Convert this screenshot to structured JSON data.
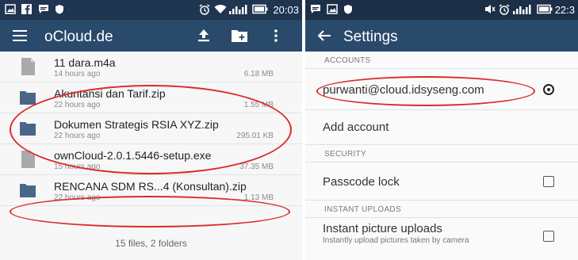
{
  "colors": {
    "app_bar": "#2a4a6c",
    "status_bar": "#1f3550",
    "annotation": "#dd2a2a"
  },
  "left_screen": {
    "status_bar": {
      "time": "20:03",
      "icons": [
        "image-icon",
        "facebook-icon",
        "chat-icon",
        "shield-icon",
        "alarm-icon",
        "wifi-icon",
        "signal-icon",
        "battery-icon"
      ]
    },
    "app_bar": {
      "title": "oCloud.de",
      "icons": [
        "menu-icon",
        "upload-icon",
        "new-folder-icon",
        "more-icon"
      ]
    },
    "files": [
      {
        "name": "11 dara.m4a",
        "time": "14 hours ago",
        "size": "6.18 MB",
        "kind": "file"
      },
      {
        "name": "Akuntansi dan Tarif.zip",
        "time": "22 hours ago",
        "size": "1.55 MB",
        "kind": "archive"
      },
      {
        "name": "Dokumen Strategis RSIA XYZ.zip",
        "time": "22 hours ago",
        "size": "295.01 KB",
        "kind": "archive"
      },
      {
        "name": "ownCloud-2.0.1.5446-setup.exe",
        "time": "15 hours ago",
        "size": "37.35 MB",
        "kind": "file"
      },
      {
        "name": "RENCANA SDM RS...4 (Konsultan).zip",
        "time": "22 hours ago",
        "size": "1.13 MB",
        "kind": "archive"
      }
    ],
    "footer": "15 files, 2 folders"
  },
  "right_screen": {
    "status_bar": {
      "time": "22:3",
      "icons": [
        "chat-icon",
        "image-icon",
        "shield-icon",
        "mute-icon",
        "alarm-icon",
        "signal-icon",
        "battery-icon"
      ]
    },
    "app_bar": {
      "title": "Settings",
      "icons": [
        "back-arrow-icon"
      ]
    },
    "sections": {
      "accounts_header": "ACCOUNTS",
      "account_email": "purwanti@cloud.idsyseng.com",
      "add_account": "Add account",
      "security_header": "SECURITY",
      "passcode_lock": "Passcode lock",
      "instant_uploads_header": "INSTANT UPLOADS",
      "instant_picture_uploads": "Instant picture uploads",
      "instant_picture_uploads_sub": "Instantly upload pictures taken by camera"
    }
  }
}
